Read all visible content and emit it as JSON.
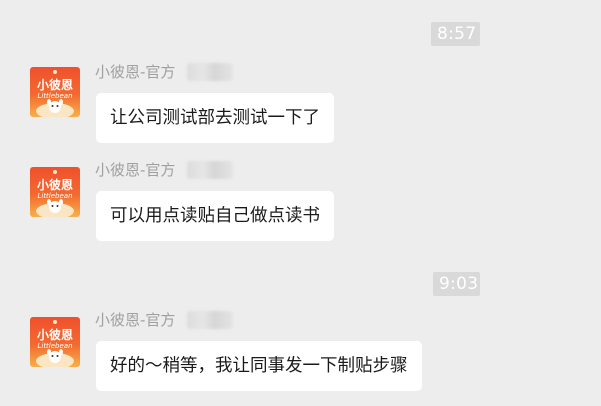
{
  "conversation": {
    "time_badges": [
      "8:57",
      "9:03"
    ],
    "messages": [
      {
        "sender": "小彼恩-官方",
        "text": "让公司测试部去测试一下了"
      },
      {
        "sender": "小彼恩-官方",
        "text": "可以用点读贴自己做点读书"
      },
      {
        "sender": "小彼恩-官方",
        "text": "好的～稍等，我让同事发一下制贴步骤"
      }
    ]
  },
  "avatar": {
    "logo_text_cn": "小彼恩",
    "logo_text_en": "Littlebean",
    "colors": {
      "bg_top": "#f0502c",
      "bg_bottom": "#f7b04a",
      "cream": "#fbe6c4"
    }
  },
  "colors": {
    "background": "#ededed",
    "bubble": "#ffffff",
    "time_badge_bg": "#d9d9d9",
    "sender_name": "#a0a0a0",
    "message_text": "#1a1a1a"
  }
}
